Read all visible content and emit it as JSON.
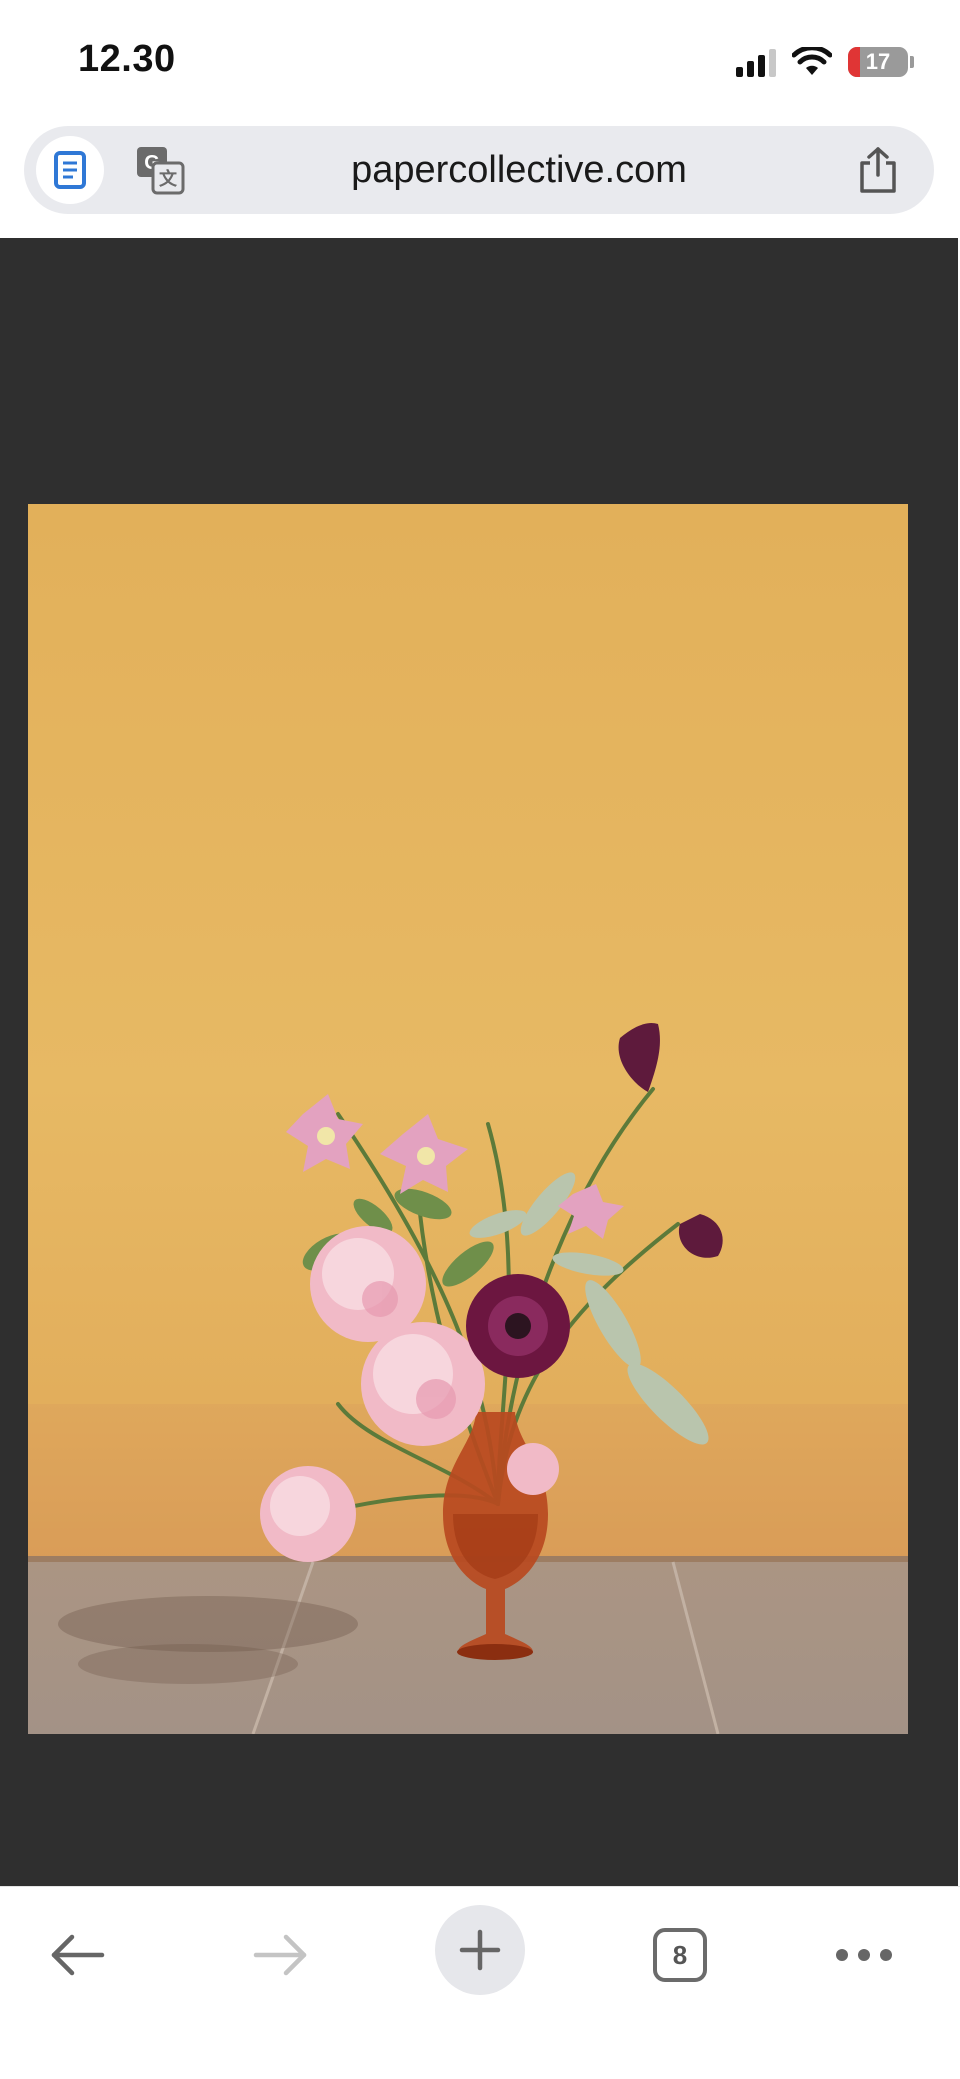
{
  "status_bar": {
    "time": "12.30",
    "battery_level": "17",
    "signal_icon": "cellular-signal-icon",
    "wifi_icon": "wifi-icon"
  },
  "address_bar": {
    "url": "papercollective.com",
    "reader_icon": "document-icon",
    "translate_icon": "translate-icon",
    "share_icon": "share-icon"
  },
  "content": {
    "artwork_icon": "flower-vase-artwork"
  },
  "toolbar": {
    "tabs_count": "8",
    "back_icon": "back-arrow-icon",
    "forward_icon": "forward-arrow-icon",
    "new_tab_icon": "plus-icon",
    "more_icon": "more-icon"
  },
  "colors": {
    "page_background": "#2f2f2f",
    "wall": "#e3b45c",
    "floor": "#a99687",
    "accent_blue": "#2f78d6",
    "battery_red": "#e03535"
  }
}
